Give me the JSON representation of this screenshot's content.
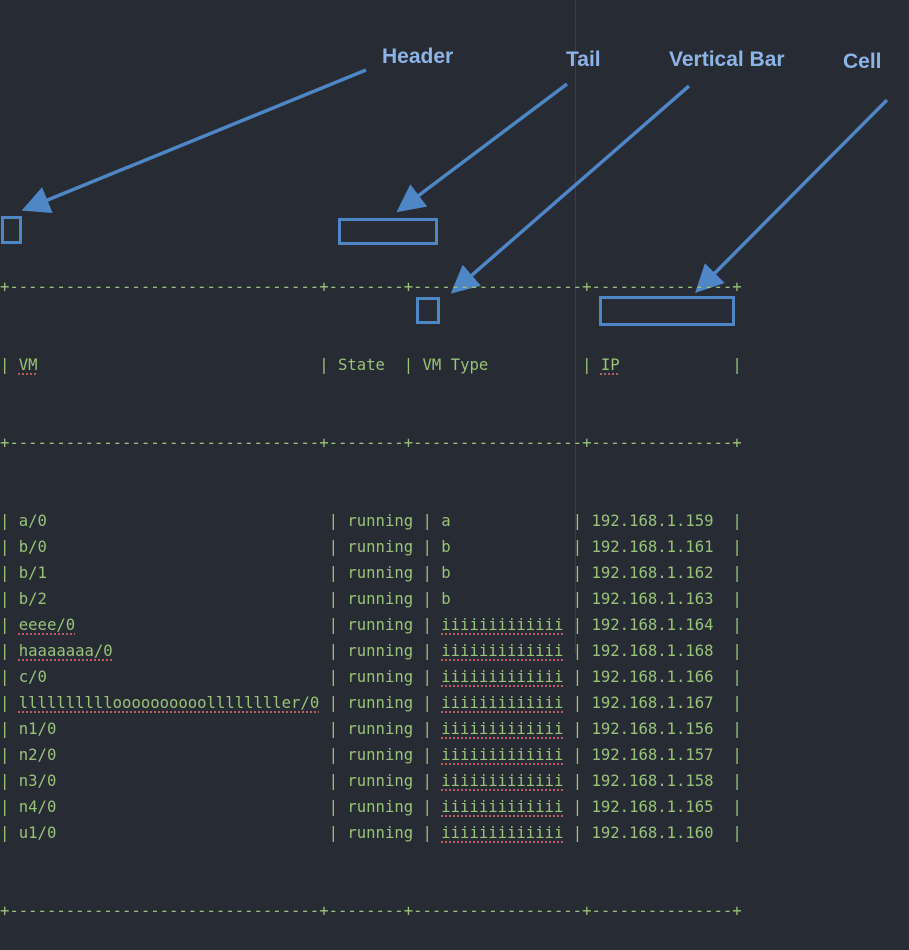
{
  "annotations": {
    "header": "Header",
    "tail": "Tail",
    "vertical_bar": "Vertical Bar",
    "cell": "Cell"
  },
  "table": {
    "border_top": "+---------------------------------+--------+------------------+---------------+",
    "header_row": [
      "VM",
      "State",
      "VM Type",
      "IP"
    ],
    "separator": "+---------------------------------+--------+------------------+---------------+",
    "rows": [
      [
        "a/0",
        "running",
        "a",
        "192.168.1.159"
      ],
      [
        "b/0",
        "running",
        "b",
        "192.168.1.161"
      ],
      [
        "b/1",
        "running",
        "b",
        "192.168.1.162"
      ],
      [
        "b/2",
        "running",
        "b",
        "192.168.1.163"
      ],
      [
        "eeee/0",
        "running",
        "iiiiiiiiiiiii",
        "192.168.1.164"
      ],
      [
        "haaaaaaa/0",
        "running",
        "iiiiiiiiiiiii",
        "192.168.1.168"
      ],
      [
        "c/0",
        "running",
        "iiiiiiiiiiiii",
        "192.168.1.166"
      ],
      [
        "lllllllllloooooooooollllllller/0",
        "running",
        "iiiiiiiiiiiii",
        "192.168.1.167"
      ],
      [
        "n1/0",
        "running",
        "iiiiiiiiiiiii",
        "192.168.1.156"
      ],
      [
        "n2/0",
        "running",
        "iiiiiiiiiiiii",
        "192.168.1.157"
      ],
      [
        "n3/0",
        "running",
        "iiiiiiiiiiiii",
        "192.168.1.158"
      ],
      [
        "n4/0",
        "running",
        "iiiiiiiiiiiii",
        "192.168.1.165"
      ],
      [
        "u1/0",
        "running",
        "iiiiiiiiiiiii",
        "192.168.1.160"
      ]
    ],
    "border_bottom": "+---------------------------------+--------+------------------+---------------+"
  },
  "colors": {
    "background": "#272b33",
    "text": "#98c379",
    "annotation": "#4f86c6",
    "spellcheck": "#e06c75"
  }
}
